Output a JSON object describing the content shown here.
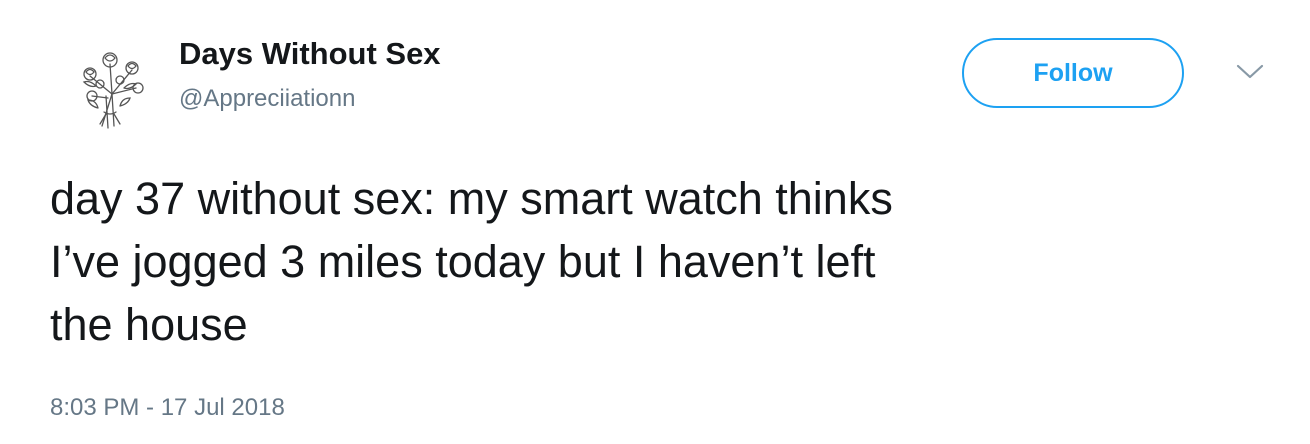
{
  "tweet": {
    "author": {
      "display_name": "Days Without Sex",
      "handle": "@Appreciiationn",
      "avatar_icon": "flower-bouquet-sketch-icon"
    },
    "follow_label": "Follow",
    "more_icon": "chevron-down-icon",
    "text": "day 37 without sex: my smart watch thinks\nI’ve jogged 3 miles today but I haven’t left\nthe house",
    "timestamp": "8:03 PM - 17 Jul 2018"
  },
  "colors": {
    "text_primary": "#14171a",
    "text_secondary": "#657786",
    "accent": "#1da1f2",
    "chevron": "#8899a6"
  }
}
